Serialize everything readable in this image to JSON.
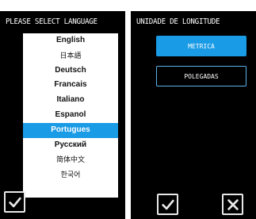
{
  "left_screen": {
    "title": "PLEASE SELECT LANGUAGE",
    "languages": [
      {
        "label": "English"
      },
      {
        "label": "日本語"
      },
      {
        "label": "Deutsch"
      },
      {
        "label": "Francais"
      },
      {
        "label": "Italiano"
      },
      {
        "label": "Espanol"
      },
      {
        "label": "Portugues"
      },
      {
        "label": "Русский"
      },
      {
        "label": "简体中文"
      },
      {
        "label": "한국어"
      }
    ],
    "selected_language": "Portugues",
    "confirm_icon": "check-icon"
  },
  "right_screen": {
    "title": "UNIDADE DE LONGITUDE",
    "options": [
      {
        "label": "METRICA"
      },
      {
        "label": "POLEGADAS"
      }
    ],
    "selected_option": "METRICA",
    "confirm_icon": "check-icon",
    "cancel_icon": "close-icon"
  },
  "colors": {
    "accent": "#1a9be6",
    "screen_background": "#000000",
    "list_background": "#ffffff",
    "outline": "#5ab3ea"
  }
}
